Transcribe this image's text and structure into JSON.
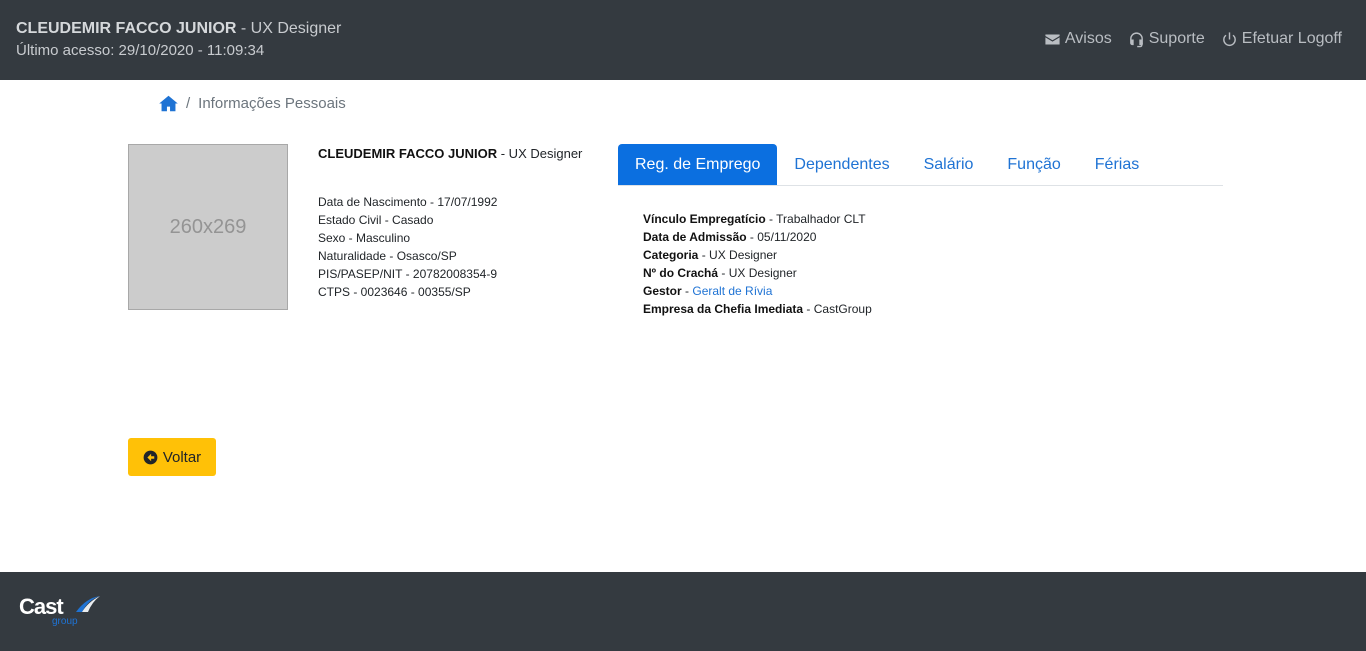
{
  "header": {
    "user_name": "CLEUDEMIR FACCO JUNIOR",
    "user_role": " - UX Designer",
    "last_access": "Último acesso: 29/10/2020 - 11:09:34",
    "nav": [
      {
        "label": "Avisos",
        "icon": "envelope-icon"
      },
      {
        "label": "Suporte",
        "icon": "headset-icon"
      },
      {
        "label": "Efetuar Logoff",
        "icon": "power-icon"
      }
    ]
  },
  "breadcrumb": {
    "home_icon": "home-icon",
    "separator": "/",
    "current": "Informações Pessoais"
  },
  "profile": {
    "photo_placeholder": "260x269",
    "name": "CLEUDEMIR FACCO JUNIOR",
    "role": " - UX Designer",
    "details": [
      "Data de Nascimento - 17/07/1992",
      "Estado Civil - Casado",
      "Sexo - Masculino",
      "Naturalidade - Osasco/SP",
      "PIS/PASEP/NIT - 20782008354-9",
      "CTPS - 0023646 - 00355/SP"
    ]
  },
  "tabs": [
    {
      "label": "Reg. de Emprego",
      "active": true
    },
    {
      "label": "Dependentes",
      "active": false
    },
    {
      "label": "Salário",
      "active": false
    },
    {
      "label": "Função",
      "active": false
    },
    {
      "label": "Férias",
      "active": false
    }
  ],
  "employment": [
    {
      "label": "Vínculo Empregatício",
      "value": " - Trabalhador CLT"
    },
    {
      "label": "Data de Admissão",
      "value": " - 05/11/2020"
    },
    {
      "label": "Categoria",
      "value": " - UX Designer"
    },
    {
      "label": "Nº do Crachá",
      "value": " - UX Designer"
    },
    {
      "label": "Gestor",
      "value": " - ",
      "link": "Geralt de Rívia"
    },
    {
      "label": "Empresa da Chefia Imediata",
      "value": " - CastGroup"
    }
  ],
  "back_button": {
    "label": "Voltar",
    "icon": "arrow-circle-left-icon"
  },
  "footer": {
    "logo_main": "Cast",
    "logo_sub": "group"
  },
  "colors": {
    "header_bg": "#343a40",
    "accent": "#0b6fe0",
    "button": "#ffc107"
  }
}
